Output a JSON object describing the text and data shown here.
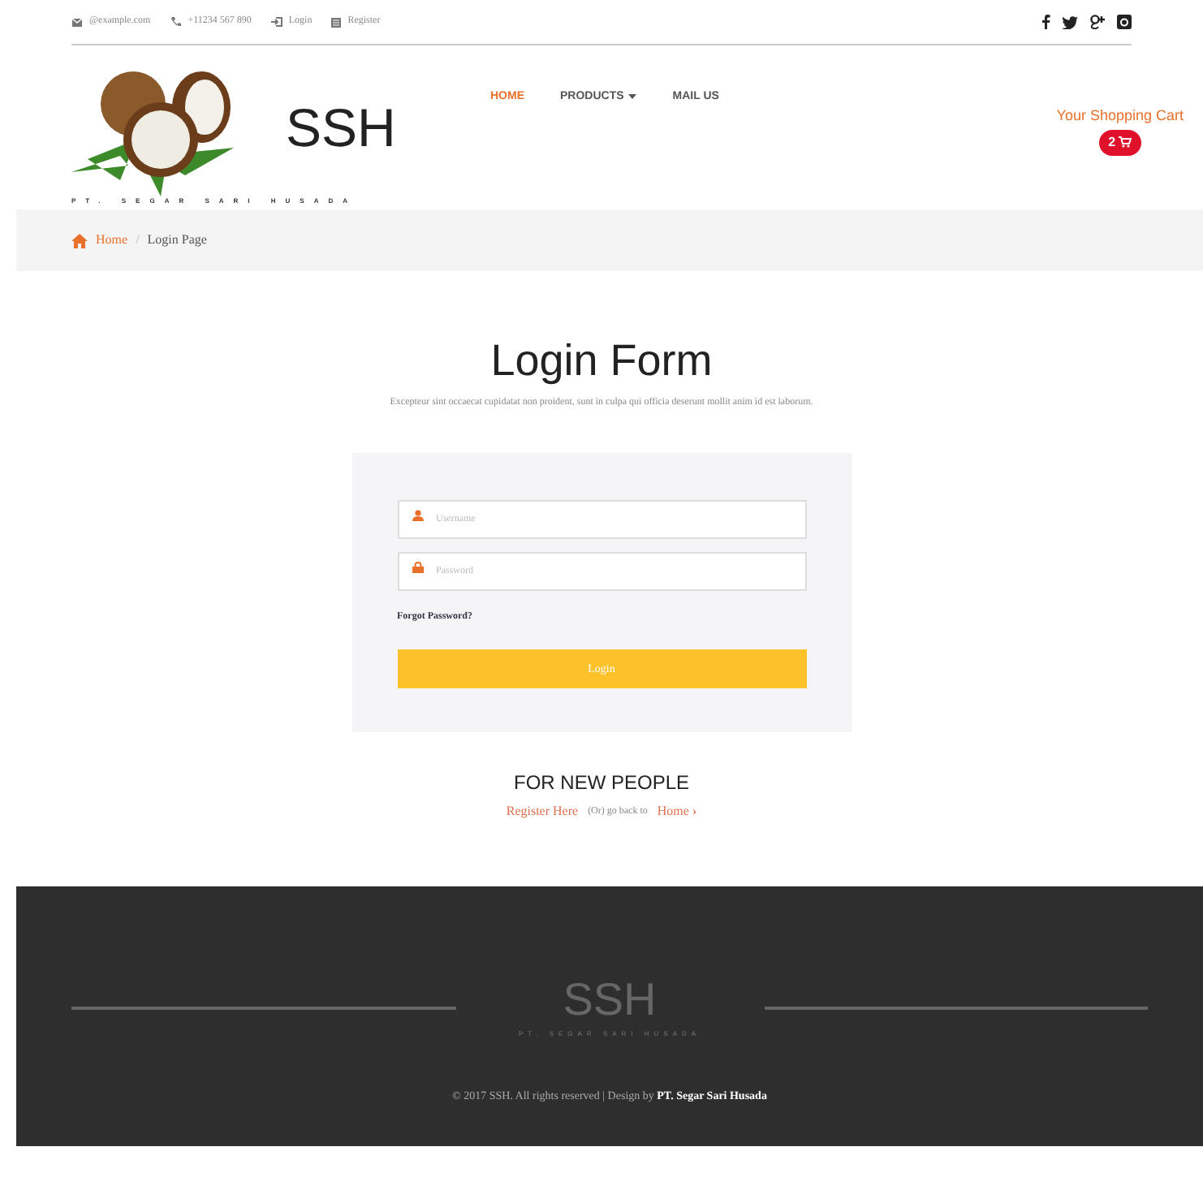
{
  "top_bar": {
    "email": "@example.com",
    "phone": "+11234 567 890",
    "links": [
      "Login",
      "Register"
    ]
  },
  "header": {
    "brand": "SSH",
    "tagline": "PT. SEGAR SARI HUSADA",
    "nav": [
      {
        "label": "HOME",
        "selected": true,
        "dropdown": false
      },
      {
        "label": "PRODUCTS",
        "selected": false,
        "dropdown": true
      },
      {
        "label": "MAIL US",
        "selected": false,
        "dropdown": false
      }
    ],
    "cart": {
      "label": "Your Shopping Cart",
      "count": "2"
    }
  },
  "breadcrumb_separator": "/",
  "breadcrumb": [
    {
      "label": "Home",
      "link": true
    },
    {
      "label": "Login Page",
      "link": false
    }
  ],
  "login": {
    "title": "Login Form",
    "subtitle": "Excepteur sint occaecat cupidatat non proident, sunt in culpa qui officia deserunt mollit anim id est laborum.",
    "username_placeholder": "Username",
    "password_placeholder": "Password",
    "forgot": "Forgot Password?",
    "button": "Login"
  },
  "new_people": {
    "heading": "FOR NEW PEOPLE",
    "register": "Register Here",
    "middle": "(Or) go back to",
    "home": "Home",
    "arrow": "›"
  },
  "footer": {
    "brand": "SSH",
    "tagline": "PT. SEGAR SARI HUSADA",
    "copyright": "© 2017 SSH. All rights reserved | Design by ",
    "designer": "PT. Segar Sari Husada"
  }
}
